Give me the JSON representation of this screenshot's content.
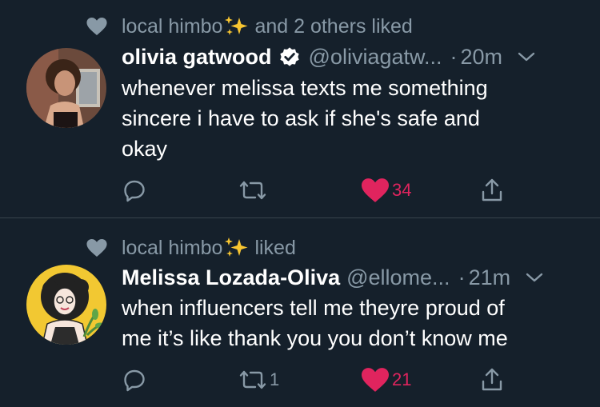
{
  "tweets": [
    {
      "context_user": "local himbo",
      "context_suffix": "and 2 others liked",
      "author_name": "olivia gatwood",
      "verified": true,
      "handle": "@oliviagatw...",
      "dot": "·",
      "time": "20m",
      "text_lines": [
        "whenever melissa texts me something",
        "sincere i have to ask if she's safe and",
        "okay"
      ],
      "reply_count": "",
      "retweet_count": "",
      "like_count": "34",
      "liked": true
    },
    {
      "context_user": "local himbo",
      "context_suffix": "liked",
      "author_name": "Melissa Lozada-Oliva",
      "verified": false,
      "handle": "@ellome...",
      "dot": "·",
      "time": "21m",
      "text_lines": [
        "when influencers tell me theyre proud of",
        "me it’s like thank you you don’t know me"
      ],
      "reply_count": "",
      "retweet_count": "1",
      "like_count": "21",
      "liked": true
    }
  ],
  "colors": {
    "background": "#15202b",
    "muted": "#8899a6",
    "like": "#e0245e",
    "divider": "#38444d",
    "text": "#ffffff"
  },
  "icons": {
    "context": "heart-icon",
    "sparkle": "sparkles-emoji",
    "verified": "verified-badge-icon",
    "more": "chevron-down-icon",
    "reply": "reply-icon",
    "retweet": "retweet-icon",
    "like": "heart-icon",
    "share": "share-icon"
  }
}
